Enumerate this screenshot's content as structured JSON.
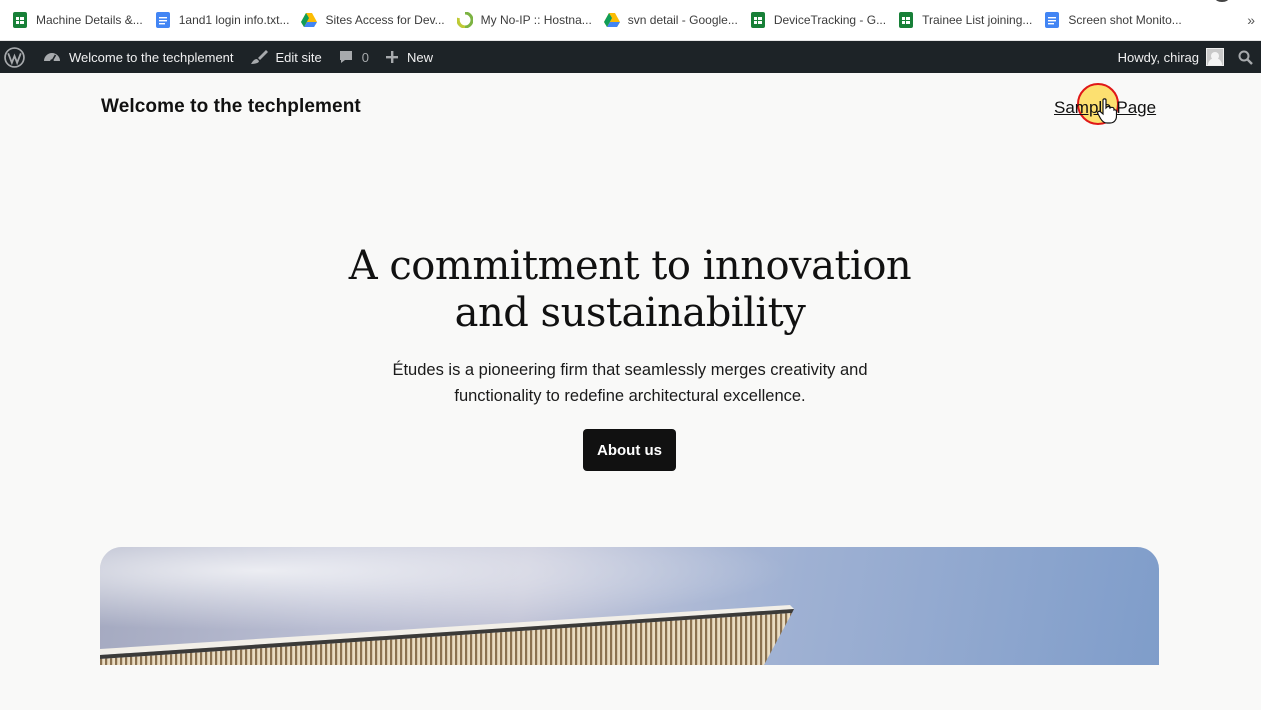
{
  "bookmarks": [
    {
      "label": "Machine Details &...",
      "icon": "google-sheets-icon",
      "color": "#188038"
    },
    {
      "label": "1and1 login info.txt...",
      "icon": "google-docs-icon",
      "color": "#4285f4"
    },
    {
      "label": "Sites Access for Dev...",
      "icon": "google-drive-icon",
      "color": "#fbbc04"
    },
    {
      "label": "My No-IP :: Hostna...",
      "icon": "noip-icon",
      "color": "#7cb342"
    },
    {
      "label": "svn detail - Google...",
      "icon": "google-drive-icon",
      "color": "#fbbc04"
    },
    {
      "label": "DeviceTracking - G...",
      "icon": "google-sheets-icon",
      "color": "#188038"
    },
    {
      "label": "Trainee List joining...",
      "icon": "google-sheets-icon",
      "color": "#188038"
    },
    {
      "label": "Screen shot Monito...",
      "icon": "google-docs-icon",
      "color": "#4285f4"
    }
  ],
  "bookmarks_overflow": "»",
  "adminbar": {
    "site_name": "Welcome to the techplement",
    "edit_site": "Edit site",
    "comments_count": "0",
    "new_label": "New",
    "howdy": "Howdy, chirag"
  },
  "site": {
    "title": "Welcome to the techplement",
    "nav_link": "Sample Page"
  },
  "hero": {
    "title_line1": "A commitment to innovation",
    "title_line2": "and sustainability",
    "desc_line1": "Études is a pioneering firm that seamlessly merges creativity and",
    "desc_line2": "functionality to redefine architectural excellence.",
    "button": "About us"
  },
  "colors": {
    "adminbar_bg": "#1d2327",
    "page_bg": "#f9f9f8",
    "button_bg": "#111111"
  }
}
